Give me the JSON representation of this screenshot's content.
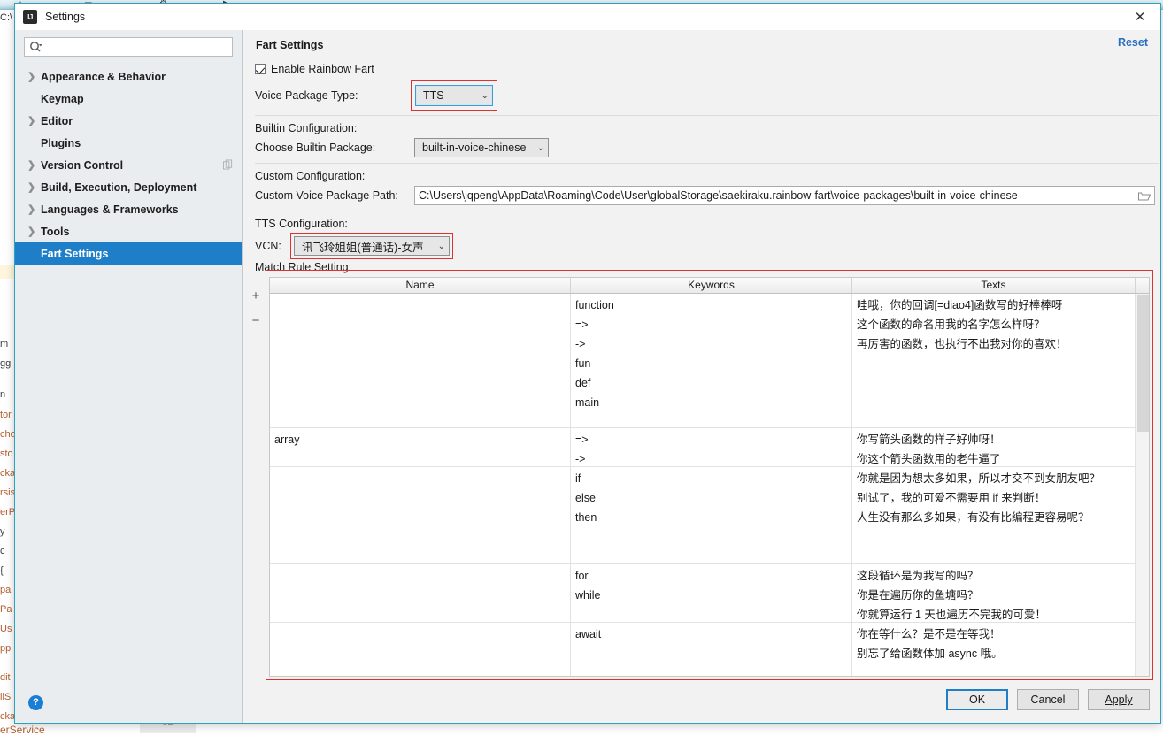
{
  "window": {
    "title": "Settings",
    "app_icon": "intellij-idea-icon",
    "close_icon": "close-icon"
  },
  "sidebar": {
    "search": {
      "placeholder": "",
      "value": "",
      "icon": "search-icon"
    },
    "items": [
      {
        "label": "Appearance & Behavior",
        "expandable": true,
        "selected": false
      },
      {
        "label": "Keymap",
        "expandable": false,
        "selected": false
      },
      {
        "label": "Editor",
        "expandable": true,
        "selected": false
      },
      {
        "label": "Plugins",
        "expandable": false,
        "selected": false
      },
      {
        "label": "Version Control",
        "expandable": true,
        "selected": false,
        "trailing_icon": "copy-icon"
      },
      {
        "label": "Build, Execution, Deployment",
        "expandable": true,
        "selected": false
      },
      {
        "label": "Languages & Frameworks",
        "expandable": true,
        "selected": false
      },
      {
        "label": "Tools",
        "expandable": true,
        "selected": false
      },
      {
        "label": "Fart Settings",
        "expandable": false,
        "selected": true
      }
    ],
    "help_label": "?"
  },
  "content": {
    "title": "Fart Settings",
    "reset_label": "Reset",
    "enable_rainbow": {
      "label": "Enable Rainbow Fart",
      "checked": true
    },
    "voice_package_type": {
      "label": "Voice Package Type:",
      "value": "TTS",
      "highlighted": true
    },
    "builtin_section": "Builtin Configuration:",
    "choose_builtin": {
      "label": "Choose Builtin Package:",
      "value": "built-in-voice-chinese"
    },
    "custom_section": "Custom Configuration:",
    "custom_path": {
      "label": "Custom Voice Package Path:",
      "value": "C:\\Users\\jqpeng\\AppData\\Roaming\\Code\\User\\globalStorage\\saekiraku.rainbow-fart\\voice-packages\\built-in-voice-chinese",
      "browse_icon": "folder-icon"
    },
    "tts_section": "TTS Configuration:",
    "vcn": {
      "label": "VCN:",
      "value": "讯飞玲姐姐(普通话)-女声",
      "highlighted": true
    },
    "match_rule_label": "Match Rule Setting:"
  },
  "table": {
    "add_label": "+",
    "remove_label": "−",
    "columns": [
      "Name",
      "Keywords",
      "Texts"
    ],
    "rows": [
      {
        "name": "",
        "keywords": [
          "function",
          "=>",
          "->",
          "fun",
          "def",
          "main"
        ],
        "texts": [
          "哇哦，你的回调[=diao4]函数写的好棒棒呀",
          "这个函数的命名用我的名字怎么样呀？",
          "再厉害的函数，也执行不出我对你的喜欢！"
        ]
      },
      {
        "name": "array",
        "keywords": [
          "=>",
          "->"
        ],
        "texts": [
          "你写箭头函数的样子好帅呀！",
          "你这个箭头函数用的老牛逼了"
        ]
      },
      {
        "name": "",
        "keywords": [
          "if",
          "else",
          "then"
        ],
        "texts": [
          "你就是因为想太多如果，所以才交不到女朋友吧？",
          " 别试了，我的可爱不需要用 if 来判断！",
          " 人生没有那么多如果，有没有比编程更容易呢？"
        ]
      },
      {
        "name": "",
        "keywords": [
          "for",
          "while"
        ],
        "texts": [
          "这段循环是为我写的吗？",
          "你是在遍历你的鱼塘吗？",
          "你就算运行 1 天也遍历不完我的可爱！"
        ]
      },
      {
        "name": "",
        "keywords": [
          "await"
        ],
        "texts": [
          "你在等什么？是不是在等我！",
          "别忘了给函数体加 async 哦。"
        ]
      }
    ]
  },
  "footer": {
    "ok": "OK",
    "cancel": "Cancel",
    "apply": "Apply"
  },
  "background": {
    "path_hint": "C:\\",
    "gutter_number": "52",
    "bottom_text": "erService",
    "code_fragments": [
      "m",
      "gg",
      "n",
      "tor",
      "cho",
      "sto",
      "cka",
      "rsis",
      "erP",
      "y",
      "c",
      "{",
      "pa",
      "Pa",
      "Us",
      "pp",
      "dit",
      "ilS",
      "cka"
    ]
  }
}
